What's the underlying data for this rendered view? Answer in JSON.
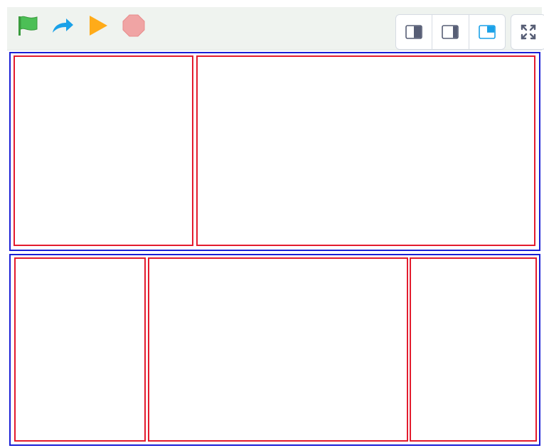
{
  "toolbar": {
    "run_controls": [
      {
        "icon": "green-flag-icon",
        "color": "#4caf50"
      },
      {
        "icon": "redo-arrow-icon",
        "color": "#1aa1e8"
      },
      {
        "icon": "play-icon",
        "color": "#ffab19"
      },
      {
        "icon": "stop-icon",
        "color": "#f0a4a4"
      }
    ],
    "layout_modes": [
      {
        "icon": "layout-left-panel-icon",
        "active": false
      },
      {
        "icon": "layout-right-panel-icon",
        "active": false
      },
      {
        "icon": "layout-corner-panel-icon",
        "active": true
      }
    ],
    "fullscreen_icon": "fullscreen-icon"
  },
  "colors": {
    "toolbar_bg": "#eff3ef",
    "row_border": "#1a1fd6",
    "panel_border": "#e31b2d",
    "active_mode": "#1aa1e8",
    "inactive_mode": "#575e75"
  }
}
